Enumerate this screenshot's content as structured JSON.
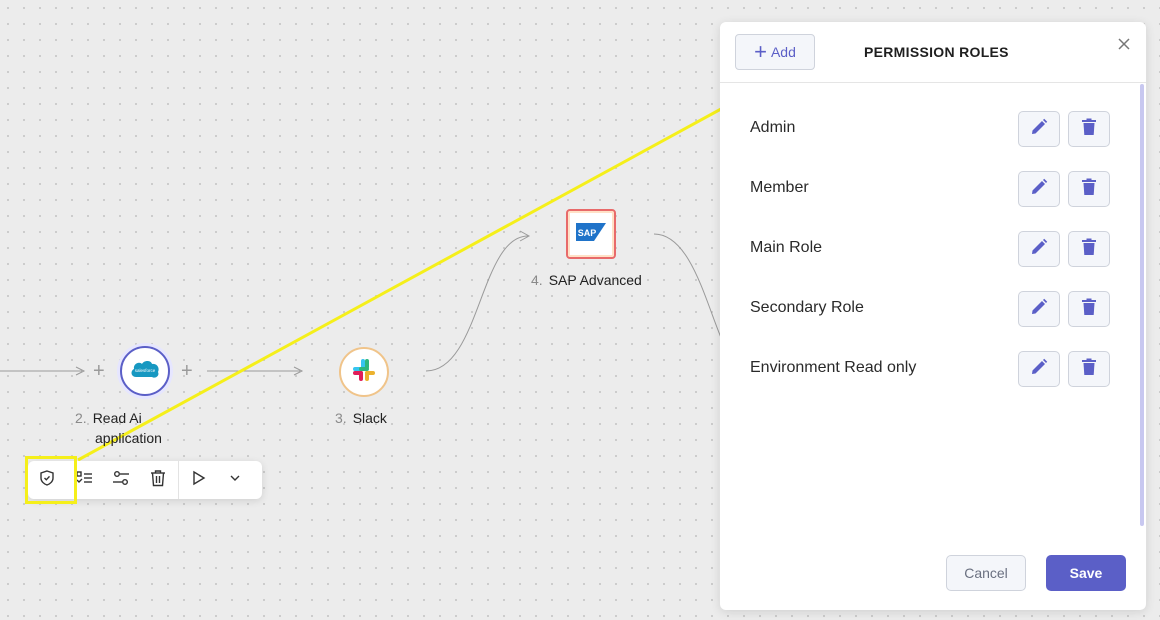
{
  "canvas": {
    "nodes": [
      {
        "number": "2.",
        "label_line1": "Read Ai",
        "label_line2": "application",
        "icon": "salesforce-icon"
      },
      {
        "number": "3.",
        "label": "Slack",
        "icon": "slack-icon"
      },
      {
        "number": "4.",
        "label": "SAP Advanced",
        "icon": "sap-icon",
        "icon_text": "SAP"
      }
    ],
    "add_symbol": "+"
  },
  "toolbar": {
    "items": [
      "shield-icon",
      "checklist-icon",
      "settings-sliders-icon",
      "trash-icon",
      "play-icon",
      "chevron-down-icon"
    ],
    "highlight_color": "#f5ef1a"
  },
  "panel": {
    "add_label": "Add",
    "add_symbol": "+",
    "title": "PERMISSION ROLES",
    "roles": [
      {
        "name": "Admin"
      },
      {
        "name": "Member"
      },
      {
        "name": "Main Role"
      },
      {
        "name": "Secondary Role"
      },
      {
        "name": "Environment Read only"
      }
    ],
    "cancel_label": "Cancel",
    "save_label": "Save"
  },
  "colors": {
    "accent": "#5b5fc7",
    "annotation": "#f5ef1a"
  }
}
